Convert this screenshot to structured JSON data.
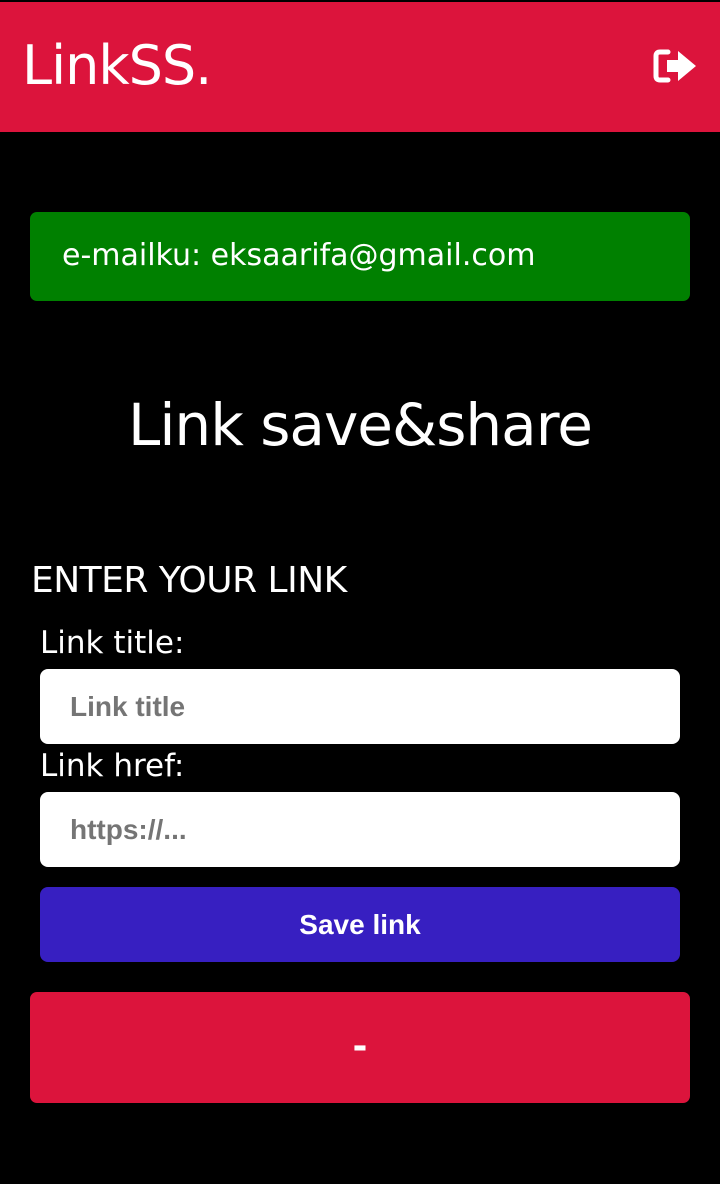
{
  "app": {
    "brand": "LinkSS.",
    "logout_icon": "sign-out-icon"
  },
  "account": {
    "email_line": "e-mailku: eksaarifa@gmail.com"
  },
  "page": {
    "title": "Link save&share"
  },
  "form": {
    "section_title": "ENTER YOUR LINK",
    "title_label": "Link title:",
    "title_placeholder": "Link title",
    "title_value": "",
    "href_label": "Link href:",
    "href_placeholder": "https://...",
    "href_value": "",
    "save_label": "Save link"
  },
  "links": {
    "empty_text": "-"
  },
  "colors": {
    "header": "#dc143c",
    "email_box": "#008000",
    "save_button": "#371fc1",
    "links_box": "#dc143c",
    "background": "#000000"
  }
}
